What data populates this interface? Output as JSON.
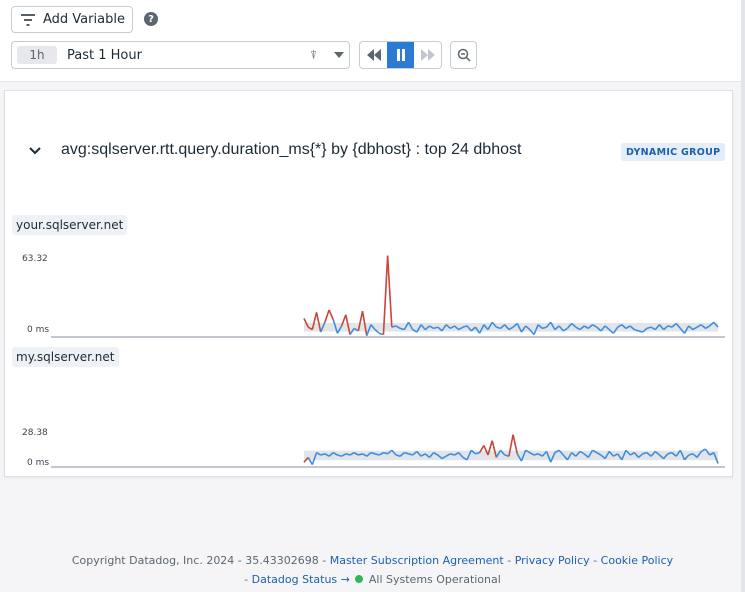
{
  "toolbar": {
    "add_variable_label": "Add Variable",
    "help_icon": "question-circle-icon",
    "time_chip": "1h",
    "time_range": "Past 1 Hour"
  },
  "widget": {
    "query_title": "avg:sqlserver.rtt.query.duration_ms{*} by {dbhost} : top 24 dbhost",
    "badge": "DYNAMIC GROUP",
    "colors": {
      "series": "#3c8ee0",
      "spike": "#c8463a",
      "band": "#d7d9de"
    },
    "groups": [
      {
        "host": "your.sqlserver.net",
        "y_max_label": "63.32",
        "y_min_label": "0 ms",
        "y_max": 63.32,
        "values": [
          15,
          8,
          6,
          20,
          4,
          12,
          22,
          14,
          3,
          9,
          18,
          2,
          7,
          5,
          21,
          1,
          10,
          6,
          3,
          2,
          66,
          8,
          9,
          7,
          6,
          12,
          6,
          4,
          10,
          6,
          9,
          7,
          8,
          5,
          10,
          7,
          9,
          6,
          8,
          9,
          5,
          8,
          3,
          10,
          6,
          12,
          8,
          7,
          10,
          6,
          8,
          11,
          4,
          9,
          6,
          2,
          10,
          7,
          8,
          12,
          6,
          9,
          5,
          7,
          11,
          8,
          6,
          9,
          7,
          10,
          8,
          5,
          9,
          6,
          3,
          8,
          10,
          7,
          9,
          6,
          5,
          4,
          7,
          8,
          6,
          10,
          6,
          9,
          8,
          11,
          7,
          3,
          9,
          6,
          8,
          10,
          7,
          9,
          12,
          8
        ]
      },
      {
        "host": "my.sqlserver.net",
        "y_max_label": "28.38",
        "y_min_label": "0 ms",
        "y_max": 28.38,
        "values": [
          4,
          8,
          2,
          12,
          10,
          11,
          9,
          12,
          10,
          9,
          11,
          10,
          12,
          10,
          11,
          9,
          12,
          11,
          10,
          12,
          11,
          14,
          10,
          9,
          12,
          11,
          10,
          13,
          9,
          11,
          8,
          12,
          10,
          7,
          9,
          11,
          10,
          12,
          8,
          6,
          14,
          11,
          12,
          18,
          10,
          22,
          8,
          14,
          10,
          9,
          27,
          11,
          5,
          14,
          12,
          10,
          11,
          9,
          13,
          4,
          12,
          14,
          10,
          6,
          12,
          9,
          13,
          11,
          8,
          14,
          12,
          10,
          7,
          13,
          9,
          11,
          6,
          14,
          10,
          12,
          8,
          11,
          12,
          9,
          13,
          10,
          7,
          11,
          12,
          9,
          14,
          6,
          10,
          11,
          8,
          13,
          15,
          10,
          12,
          3
        ]
      }
    ]
  },
  "footer": {
    "copyright": "Copyright Datadog, Inc. 2024 - 35.43302698 -",
    "msa": "Master Subscription Agreement",
    "privacy": "Privacy Policy",
    "cookie": "Cookie Policy",
    "status_link": "Datadog Status →",
    "status_text": "All Systems Operational"
  }
}
